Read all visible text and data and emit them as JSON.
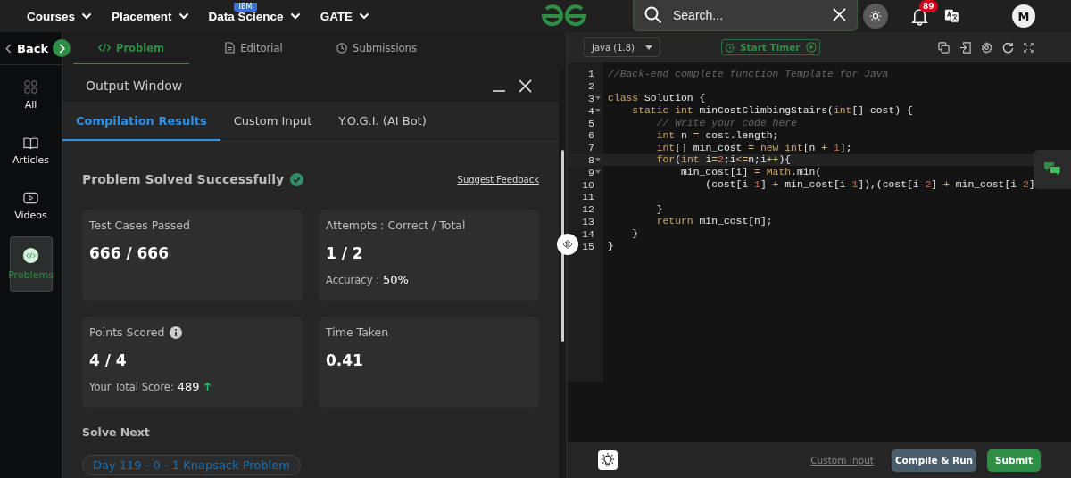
{
  "top_nav": {
    "menus": [
      {
        "label": "Courses"
      },
      {
        "label": "Placement"
      },
      {
        "label": "Data Science",
        "badge": "IBM"
      },
      {
        "label": "GATE"
      }
    ],
    "search": {
      "placeholder": "Search..."
    },
    "notifications": {
      "count": "89"
    },
    "avatar": {
      "initial": "M"
    }
  },
  "sidebar": {
    "back": "Back",
    "items": [
      {
        "label": "All",
        "selected": false
      },
      {
        "label": "Articles",
        "selected": false
      },
      {
        "label": "Videos",
        "selected": false
      },
      {
        "label": "Problems",
        "selected": true
      }
    ]
  },
  "problem_tabs": [
    {
      "label": "Problem",
      "selected": true
    },
    {
      "label": "Editorial",
      "selected": false
    },
    {
      "label": "Submissions",
      "selected": false
    }
  ],
  "output_window": {
    "title": "Output Window",
    "tabs": [
      {
        "label": "Compilation Results",
        "selected": true
      },
      {
        "label": "Custom Input",
        "selected": false
      },
      {
        "label": "Y.O.G.I. (AI Bot)",
        "selected": false
      }
    ],
    "status": "Problem Solved Successfully",
    "solved": true,
    "feedback_link": "Suggest Feedback",
    "cards": [
      {
        "label": "Test Cases Passed",
        "info": false,
        "value": "666 / 666"
      },
      {
        "label": "Attempts : Correct / Total",
        "info": false,
        "value": "1 / 2",
        "detail_label": "Accuracy :",
        "detail_value": "50%"
      },
      {
        "label": "Points Scored",
        "info": true,
        "value": "4 / 4",
        "detail_label": "Your Total Score:",
        "detail_value": "489",
        "rising": true
      },
      {
        "label": "Time Taken",
        "info": false,
        "value": "0.41"
      }
    ],
    "solve_next": {
      "heading": "Solve Next",
      "items": [
        "Day 119 - 0 - 1 Knapsack Problem"
      ]
    }
  },
  "editor": {
    "language": "Java (1.8)",
    "timer": "Start Timer",
    "lines": [
      {
        "number": "1",
        "foldable": false,
        "active": false,
        "tokens": [
          {
            "kind": "comment",
            "text": "//Back-end complete function Template for Java"
          }
        ]
      },
      {
        "number": "2",
        "foldable": false,
        "active": false
      },
      {
        "number": "3",
        "foldable": true,
        "active": false,
        "tokens": [
          {
            "kind": "keyword",
            "text": "class"
          },
          {
            "kind": "plain",
            "text": " Solution {"
          }
        ]
      },
      {
        "number": "4",
        "foldable": true,
        "active": false,
        "tokens": [
          {
            "kind": "keyword",
            "text": "    static int"
          },
          {
            "kind": "plain",
            "text": " minCostClimbingStairs("
          },
          {
            "kind": "keyword",
            "text": "int"
          },
          {
            "kind": "plain",
            "text": "[] cost) {"
          }
        ]
      },
      {
        "number": "5",
        "foldable": false,
        "active": false,
        "tokens": [
          {
            "kind": "comment",
            "text": "        // Write your code here"
          }
        ]
      },
      {
        "number": "6",
        "foldable": false,
        "active": false,
        "tokens": [
          {
            "kind": "keyword",
            "text": "        int"
          },
          {
            "kind": "plain",
            "text": " n "
          },
          {
            "kind": "operator",
            "text": "="
          },
          {
            "kind": "plain",
            "text": " cost.length;"
          }
        ]
      },
      {
        "number": "7",
        "foldable": false,
        "active": false,
        "tokens": [
          {
            "kind": "keyword",
            "text": "        int"
          },
          {
            "kind": "plain",
            "text": "[] min_cost "
          },
          {
            "kind": "operator",
            "text": "="
          },
          {
            "kind": "keyword",
            "text": " new int"
          },
          {
            "kind": "plain",
            "text": "[n "
          },
          {
            "kind": "operator",
            "text": "+"
          },
          {
            "kind": "number",
            "text": " 1"
          },
          {
            "kind": "plain",
            "text": "];"
          }
        ]
      },
      {
        "number": "8",
        "foldable": true,
        "active": true,
        "tokens": [
          {
            "kind": "keyword",
            "text": "        for"
          },
          {
            "kind": "plain",
            "text": "("
          },
          {
            "kind": "keyword",
            "text": "int"
          },
          {
            "kind": "plain",
            "text": " i"
          },
          {
            "kind": "operator",
            "text": "="
          },
          {
            "kind": "number",
            "text": "2"
          },
          {
            "kind": "plain",
            "text": ";i"
          },
          {
            "kind": "operator",
            "text": "<="
          },
          {
            "kind": "plain",
            "text": "n;i"
          },
          {
            "kind": "operator",
            "text": "++"
          },
          {
            "kind": "plain",
            "text": "){"
          }
        ]
      },
      {
        "number": "9",
        "foldable": true,
        "active": false,
        "tokens": [
          {
            "kind": "plain",
            "text": "            min_cost[i] "
          },
          {
            "kind": "operator",
            "text": "="
          },
          {
            "kind": "keyword",
            "text": " Math"
          },
          {
            "kind": "plain",
            "text": ".min("
          }
        ]
      },
      {
        "number": "10",
        "foldable": false,
        "active": false,
        "tokens": [
          {
            "kind": "plain",
            "text": "                (cost[i"
          },
          {
            "kind": "operator",
            "text": "-"
          },
          {
            "kind": "number",
            "text": "1"
          },
          {
            "kind": "plain",
            "text": "] "
          },
          {
            "kind": "operator",
            "text": "+"
          },
          {
            "kind": "plain",
            "text": " min_cost[i"
          },
          {
            "kind": "operator",
            "text": "-"
          },
          {
            "kind": "number",
            "text": "1"
          },
          {
            "kind": "plain",
            "text": "]),(cost[i"
          },
          {
            "kind": "operator",
            "text": "-"
          },
          {
            "kind": "number",
            "text": "2"
          },
          {
            "kind": "plain",
            "text": "] "
          },
          {
            "kind": "operator",
            "text": "+"
          },
          {
            "kind": "plain",
            "text": " min_cost[i"
          },
          {
            "kind": "operator",
            "text": "-"
          },
          {
            "kind": "number",
            "text": "2"
          },
          {
            "kind": "plain",
            "text": "]"
          }
        ]
      },
      {
        "number": "11",
        "foldable": false,
        "active": false
      },
      {
        "number": "12",
        "foldable": false,
        "active": false,
        "tokens": [
          {
            "kind": "plain",
            "text": "        }"
          }
        ]
      },
      {
        "number": "13",
        "foldable": false,
        "active": false,
        "tokens": [
          {
            "kind": "keyword",
            "text": "        return"
          },
          {
            "kind": "plain",
            "text": " min_cost[n];"
          }
        ]
      },
      {
        "number": "14",
        "foldable": false,
        "active": false,
        "tokens": [
          {
            "kind": "plain",
            "text": "    }"
          }
        ]
      },
      {
        "number": "15",
        "foldable": false,
        "active": false,
        "tokens": [
          {
            "kind": "plain",
            "text": "}"
          }
        ]
      }
    ],
    "footer": {
      "link": "Custom Input",
      "buttons": [
        {
          "label": "Compile & Run",
          "kind": "secondary"
        },
        {
          "label": "Submit",
          "kind": "primary"
        }
      ]
    }
  }
}
